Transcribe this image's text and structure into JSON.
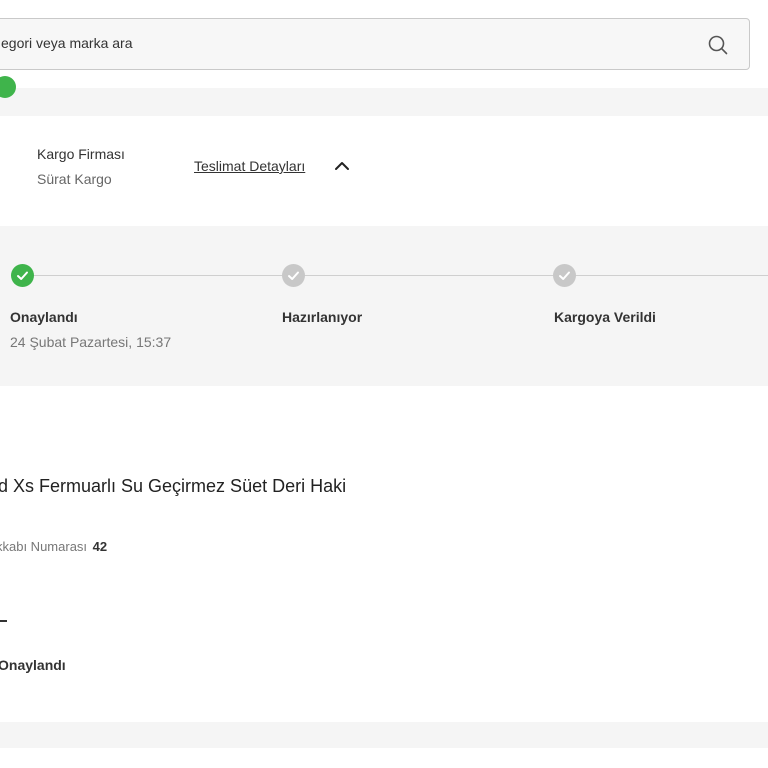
{
  "search": {
    "placeholder": "egori veya marka ara",
    "icon": "search-icon"
  },
  "cargo": {
    "title": "Kargo Firması",
    "company": "Sürat Kargo",
    "details_link": "Teslimat Detayları",
    "chevron_icon": "chevron-up-icon"
  },
  "tracking": {
    "steps": [
      {
        "label": "Onaylandı",
        "date": "24 Şubat Pazartesi, 15:37",
        "status": "done"
      },
      {
        "label": "Hazırlanıyor",
        "date": "",
        "status": "pending"
      },
      {
        "label": "Kargoya Verildi",
        "date": "",
        "status": "pending"
      }
    ]
  },
  "product": {
    "name": "d Xs Fermuarlı Su Geçirmez Süet Deri Haki",
    "size_label": "kkabı Numarası",
    "size_value": "42",
    "status": "Onaylandı"
  },
  "colors": {
    "success": "#3fb44b",
    "pending": "#c8c8c8",
    "band": "#f5f5f5"
  }
}
